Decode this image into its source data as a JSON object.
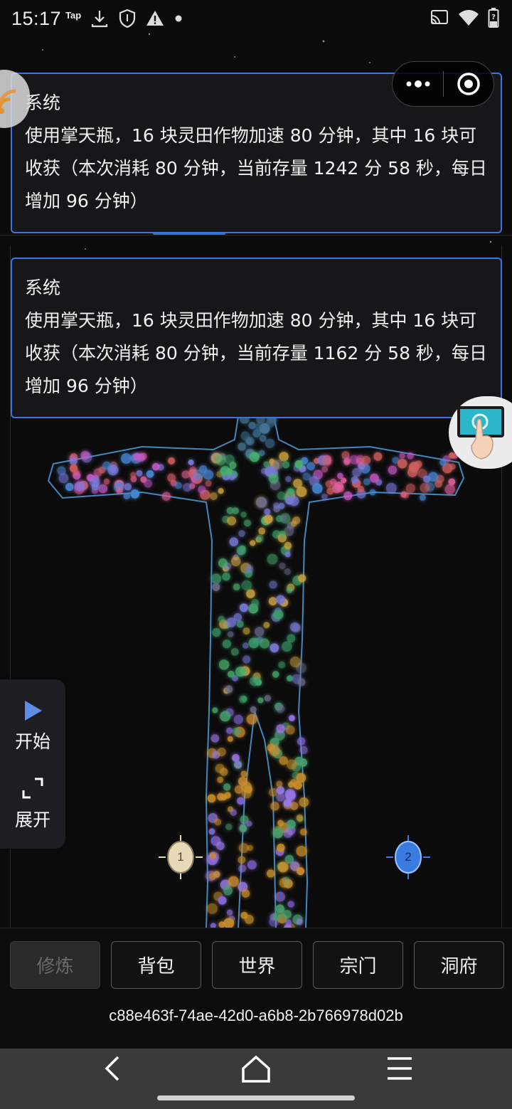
{
  "status_bar": {
    "time": "15:17",
    "tap_label": "Tap",
    "left_icons": [
      "download-icon",
      "shield-icon",
      "warning-icon",
      "dot-icon"
    ],
    "right_icons": [
      "cast-icon",
      "wifi-icon",
      "battery-icon"
    ]
  },
  "capsule": {
    "icons": [
      "more-dots-icon",
      "close-target-icon"
    ]
  },
  "messages": [
    {
      "title": "系统",
      "lines": [
        "使用掌天瓶，16 块灵田作物加速 80 分钟，其中 16 块可",
        "收获（本次消耗 80 分钟，当前存量 1242 分 58 秒，每日",
        "增加 96 分钟）"
      ]
    },
    {
      "title": "系统",
      "lines": [
        "使用掌天瓶，16 块灵田作物加速 80 分钟，其中 16 块可",
        "收获（本次消耗 80 分钟，当前存量 1162 分 58 秒，每日",
        "增加 96 分钟）"
      ]
    }
  ],
  "side_panel": {
    "start_label": "开始",
    "expand_label": "展开",
    "colors": {
      "play": "#5d8de6",
      "background": "#1e1e24"
    }
  },
  "markers": [
    {
      "label": "1",
      "color": "#e8d9b8"
    },
    {
      "label": "2",
      "color": "#3a7be0"
    }
  ],
  "nav": {
    "tabs": [
      {
        "label": "修炼",
        "active": true
      },
      {
        "label": "背包",
        "active": false
      },
      {
        "label": "世界",
        "active": false
      },
      {
        "label": "宗门",
        "active": false
      },
      {
        "label": "洞府",
        "active": false
      }
    ],
    "uuid": "c88e463f-74ae-42d0-a6b8-2b766978d02b"
  },
  "android_nav": {
    "icons": [
      "back-icon",
      "home-icon",
      "menu-icon"
    ]
  },
  "colors": {
    "accent_blue": "#3b74e6",
    "panel_bg": "#18181a",
    "body_outline": "#4aa0e0"
  }
}
